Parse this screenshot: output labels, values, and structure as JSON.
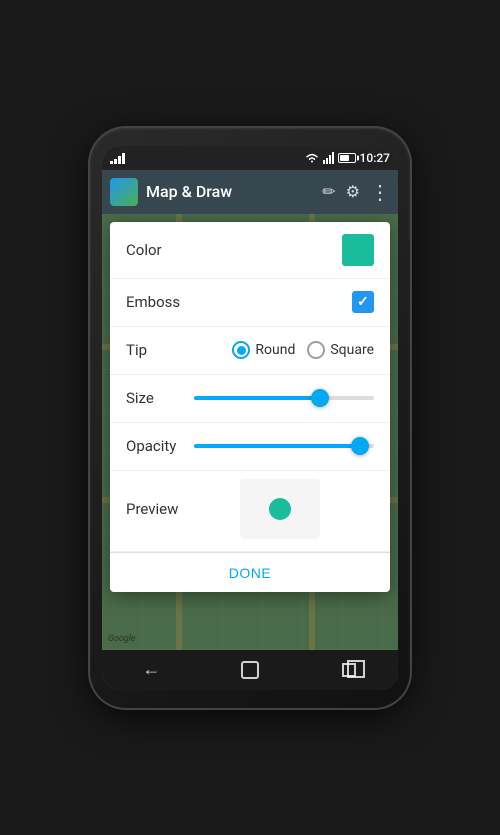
{
  "status": {
    "time": "10:27"
  },
  "appbar": {
    "title": "Map & Draw"
  },
  "dialog": {
    "color_label": "Color",
    "emboss_label": "Emboss",
    "tip_label": "Tip",
    "size_label": "Size",
    "opacity_label": "Opacity",
    "preview_label": "Preview",
    "done_label": "Done",
    "tip_round": "Round",
    "tip_square": "Square",
    "color_value": "#1abc9c",
    "emboss_checked": true,
    "tip_selected": "round",
    "size_percent": 70,
    "opacity_percent": 92
  },
  "icons": {
    "edit": "✏",
    "settings": "⚙",
    "more": "⋮",
    "back": "←",
    "home": "",
    "recents": ""
  }
}
